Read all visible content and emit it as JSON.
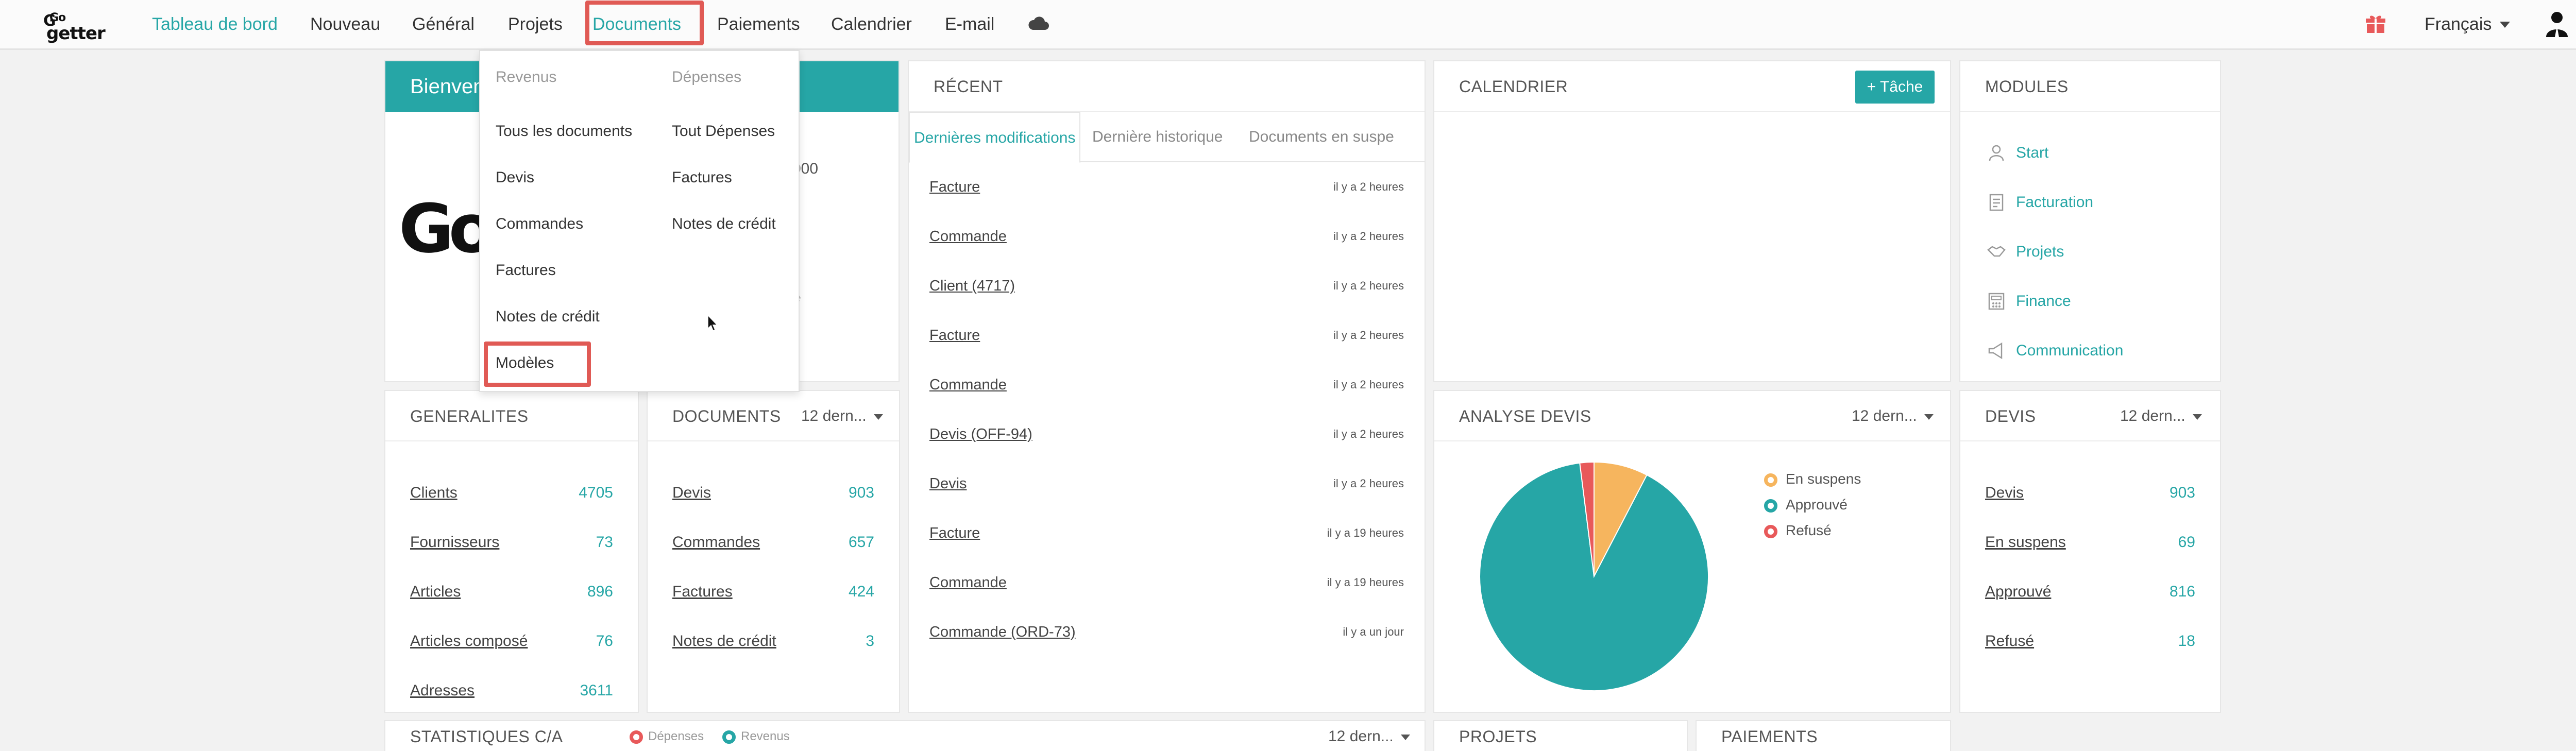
{
  "app": {
    "logo_line1": "Go",
    "logo_line2": "getter",
    "logo_mark": "G"
  },
  "nav": {
    "items": [
      {
        "label": "Tableau de bord"
      },
      {
        "label": "Nouveau"
      },
      {
        "label": "Général"
      },
      {
        "label": "Projets"
      },
      {
        "label": "Documents"
      },
      {
        "label": "Paiements"
      },
      {
        "label": "Calendrier"
      },
      {
        "label": "E-mail"
      }
    ],
    "cloud_icon": "cloud-icon",
    "gift_icon": "gift-icon",
    "language": "Français",
    "user_icon": "user-icon"
  },
  "colors": {
    "accent": "#26a6a6",
    "highlight_box": "#e05a55",
    "pie_approved": "#26a6a6",
    "pie_pending": "#f6b55e",
    "pie_refused": "#e8595a"
  },
  "documents_menu": {
    "revenus_header": "Revenus",
    "depenses_header": "Dépenses",
    "revenus_items": [
      "Tous les documents",
      "Devis",
      "Commandes",
      "Factures",
      "Notes de crédit",
      "Modèles"
    ],
    "depenses_items": [
      "Tout Dépenses",
      "Factures",
      "Notes de crédit"
    ]
  },
  "welcome": {
    "title": "Bienvenue",
    "logo_text": "Go",
    "frag1": "000",
    "frag2": "e"
  },
  "recent": {
    "title": "RÉCENT",
    "tabs": [
      "Dernières modifications",
      "Dernière historique",
      "Documents en suspe"
    ],
    "rows": [
      {
        "label": "Facture",
        "time": "il y a 2 heures"
      },
      {
        "label": "Commande",
        "time": "il y a 2 heures"
      },
      {
        "label": "Client (4717)",
        "time": "il y a 2 heures"
      },
      {
        "label": "Facture",
        "time": "il y a 2 heures"
      },
      {
        "label": "Commande",
        "time": "il y a 2 heures"
      },
      {
        "label": "Devis (OFF-94)",
        "time": "il y a 2 heures"
      },
      {
        "label": "Devis",
        "time": "il y a 2 heures"
      },
      {
        "label": "Facture",
        "time": "il y a 19 heures"
      },
      {
        "label": "Commande",
        "time": "il y a 19 heures"
      },
      {
        "label": "Commande (ORD-73)",
        "time": "il y a un jour"
      }
    ]
  },
  "calendar": {
    "title": "CALENDRIER",
    "task_button": "+ Tâche"
  },
  "modules": {
    "title": "MODULES",
    "items": [
      {
        "label": "Start",
        "icon": "person-icon"
      },
      {
        "label": "Facturation",
        "icon": "invoice-icon"
      },
      {
        "label": "Projets",
        "icon": "handshake-icon"
      },
      {
        "label": "Finance",
        "icon": "calculator-icon"
      },
      {
        "label": "Communication",
        "icon": "megaphone-icon"
      }
    ]
  },
  "generalites": {
    "title": "GENERALITES",
    "rows": [
      {
        "label": "Clients",
        "value": "4705"
      },
      {
        "label": "Fournisseurs",
        "value": "73"
      },
      {
        "label": "Articles",
        "value": "896"
      },
      {
        "label": "Articles composé",
        "value": "76"
      },
      {
        "label": "Adresses",
        "value": "3611"
      }
    ]
  },
  "documents": {
    "title": "DOCUMENTS",
    "period": "12 dern...",
    "rows": [
      {
        "label": "Devis",
        "value": "903"
      },
      {
        "label": "Commandes",
        "value": "657"
      },
      {
        "label": "Factures",
        "value": "424"
      },
      {
        "label": "Notes de crédit",
        "value": "3"
      }
    ]
  },
  "analyse_devis": {
    "title": "ANALYSE DEVIS",
    "period": "12 dern...",
    "legend": [
      "En suspens",
      "Approuvé",
      "Refusé"
    ]
  },
  "chart_data": {
    "type": "pie",
    "categories": [
      "En suspens",
      "Approuvé",
      "Refusé"
    ],
    "values": [
      69,
      816,
      18
    ],
    "colors": [
      "#f6b55e",
      "#26a6a6",
      "#e8595a"
    ],
    "title": "ANALYSE DEVIS"
  },
  "devis": {
    "title": "DEVIS",
    "period": "12 dern...",
    "rows": [
      {
        "label": "Devis",
        "value": "903"
      },
      {
        "label": "En suspens",
        "value": "69"
      },
      {
        "label": "Approuvé",
        "value": "816"
      },
      {
        "label": "Refusé",
        "value": "18"
      }
    ]
  },
  "stats_ca": {
    "title": "STATISTIQUES C/A",
    "legend_depenses": "Dépenses",
    "legend_revenus": "Revenus",
    "period": "12 dern..."
  },
  "projets_panel": {
    "title": "PROJETS"
  },
  "paiements_panel": {
    "title": "PAIEMENTS"
  }
}
